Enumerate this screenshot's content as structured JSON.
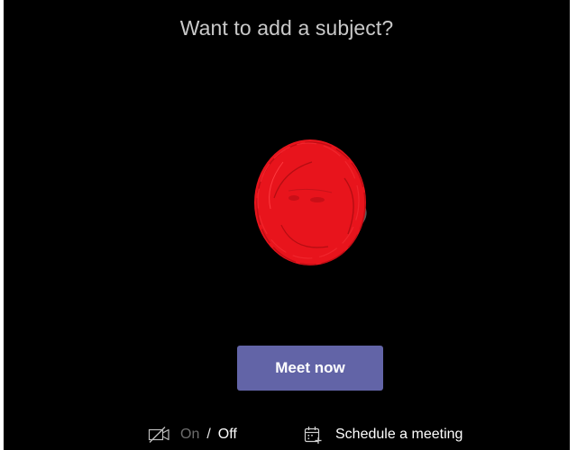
{
  "header": {
    "subject_prompt": "Want to add a subject?"
  },
  "avatar": {
    "fill_color": "#e8141c",
    "description_icon": "avatar-icon"
  },
  "actions": {
    "meet_now_label": "Meet now",
    "meet_now_color": "#6264a7"
  },
  "bottom_bar": {
    "video_on_label": "On",
    "separator": "/",
    "video_off_label": "Off",
    "video_icon": "video-off-icon",
    "schedule_label": "Schedule a meeting",
    "schedule_icon": "calendar-add-icon"
  }
}
